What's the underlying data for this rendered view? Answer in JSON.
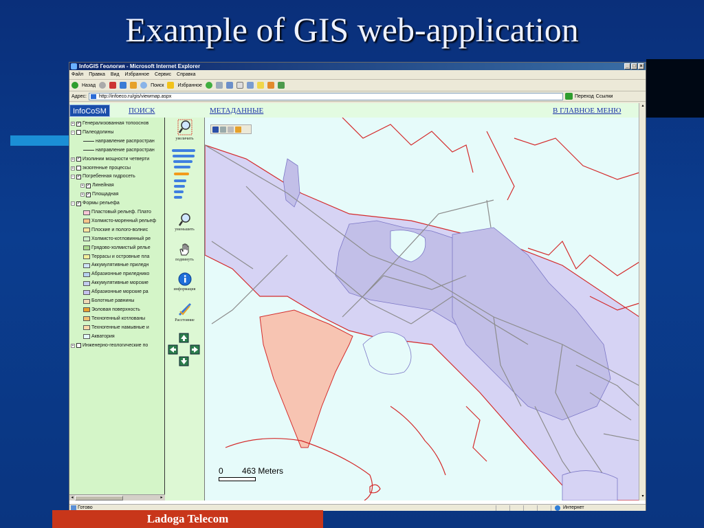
{
  "slide": {
    "title": "Example of GIS web-application",
    "footer": "Ladoga Telecom"
  },
  "browser": {
    "window_title": "InfoGIS Геология - Microsoft Internet Explorer",
    "menu": [
      "Файл",
      "Правка",
      "Вид",
      "Избранное",
      "Сервис",
      "Справка"
    ],
    "toolbar": {
      "back": "Назад",
      "search": "Поиск",
      "favorites": "Избранное"
    },
    "address_label": "Адрес:",
    "url": "http://infoeco.ru/gis/viewmap.aspx",
    "go_label": "Переход",
    "links_label": "Ссылки",
    "status_text": "Готово",
    "zone_text": "Интернет"
  },
  "app": {
    "brand": "InfoCoSM",
    "nav": {
      "search": "ПОИСК",
      "metadata": "МЕТАДАННЫЕ",
      "home": "В ГЛАВНОЕ МЕНЮ"
    },
    "layers": [
      {
        "label": "Генерализованная топооснов",
        "checked": true,
        "expand": "+"
      },
      {
        "label": "Палеодолины",
        "checked": false,
        "expand": "−"
      },
      {
        "label": "направление распростран",
        "line": true
      },
      {
        "label": "направление распростран",
        "line": true
      },
      {
        "label": "Изолинии мощности четверти",
        "checked": true,
        "expand": "+"
      },
      {
        "label": "экзогенные процессы",
        "checked": false,
        "expand": "+"
      },
      {
        "label": "Погребенная гидросеть",
        "checked": true,
        "expand": "−"
      },
      {
        "label": "Линейная",
        "checked": true,
        "expand": "+",
        "indent": 1
      },
      {
        "label": "Площадная",
        "checked": true,
        "expand": "+",
        "indent": 1
      },
      {
        "label": "Формы рельефа",
        "checked": true,
        "expand": "−"
      },
      {
        "label": "Пластовый рельеф. Плато",
        "swatch": "#f7c6d6"
      },
      {
        "label": "Холмисто-моренный рельеф",
        "swatch": "#f5c48a"
      },
      {
        "label": "Плоские и полого-волнис",
        "swatch": "#f8e3a0"
      },
      {
        "label": "Холмисто-котловинный ре",
        "swatch": "#cdeec8"
      },
      {
        "label": "Грядово-холмистый релье",
        "swatch": "#a8d68c"
      },
      {
        "label": "Террасы и островные пла",
        "swatch": "#f2ef9a"
      },
      {
        "label": "Аккумулятивные приледн",
        "swatch": "#cfe4f7"
      },
      {
        "label": "Абразионные приледнико",
        "swatch": "#b7d2f0"
      },
      {
        "label": "Аккумулятивные морские",
        "swatch": "#c4cef0"
      },
      {
        "label": "Абразионные морские ра",
        "swatch": "#c7c3ef"
      },
      {
        "label": "Болотные равнины",
        "swatch": "#f0d9b6"
      },
      {
        "label": "Эоловая поверхность",
        "swatch": "#e8a030"
      },
      {
        "label": "Техногенный котлованы",
        "swatch": "#f0c070"
      },
      {
        "label": "Техногенные намывные и",
        "swatch": "#f8d8a8"
      },
      {
        "label": "Акватория",
        "swatch": "#e4fbfb"
      },
      {
        "label": "Инженерно-геологические по",
        "checked": false,
        "expand": "+"
      }
    ],
    "tools": {
      "zoom_in": "увеличить",
      "zoom_out": "уменьшить",
      "pan": "подвинуть",
      "info": "информация",
      "distance": "Расстояние"
    },
    "zoom_level": 5,
    "scale": {
      "zero": "0",
      "distance": "463 Meters"
    },
    "colors": {
      "land": "#d6d3f4",
      "lowland": "#c2bfe8",
      "highlight": "#f7c4b2",
      "water": "#e6fbfa",
      "coast": "#d42a2a",
      "roads": "#8c8c8c"
    }
  }
}
